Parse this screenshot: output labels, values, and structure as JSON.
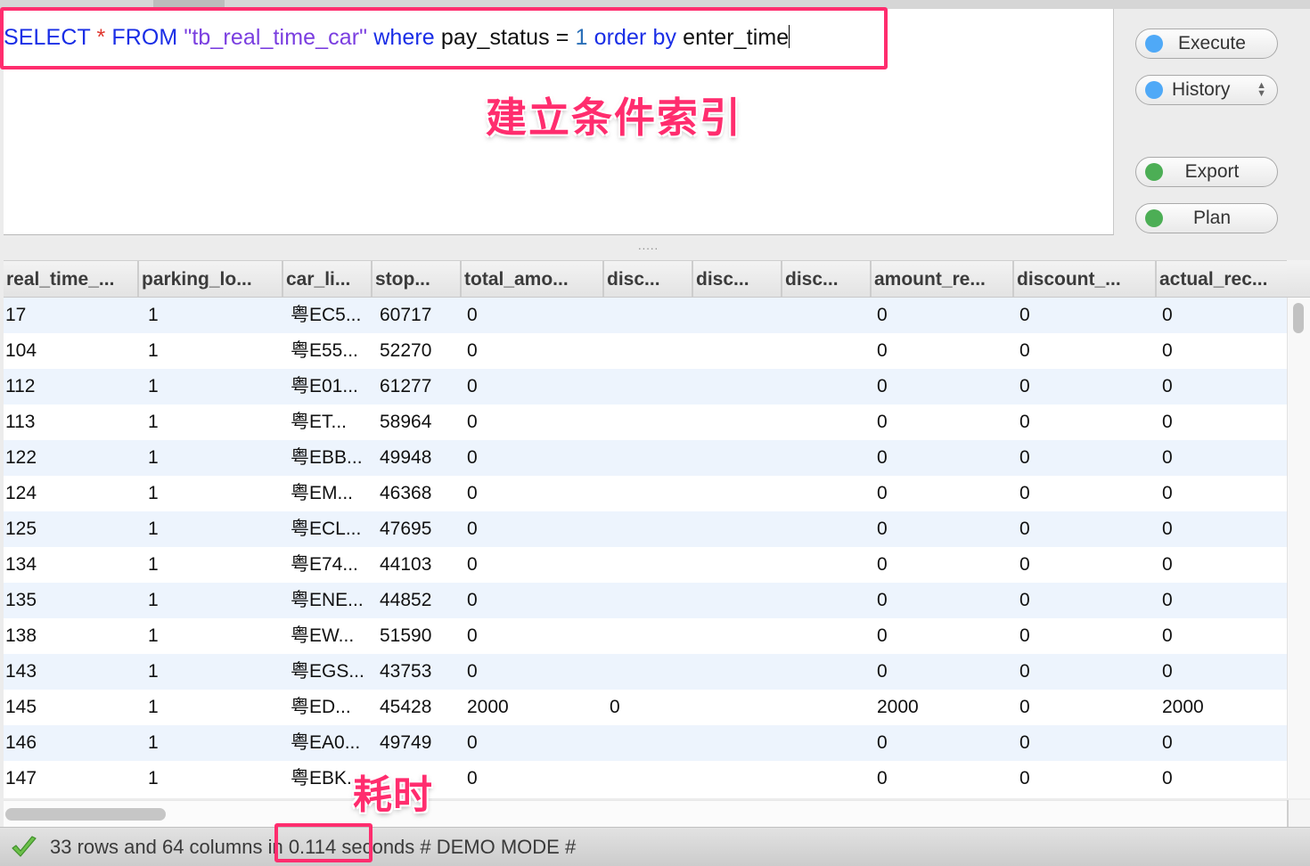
{
  "editor": {
    "sql_tokens": [
      {
        "t": "SELECT",
        "c": "kw"
      },
      {
        "t": " ",
        "c": "plain"
      },
      {
        "t": "*",
        "c": "star"
      },
      {
        "t": " ",
        "c": "plain"
      },
      {
        "t": "FROM",
        "c": "kw"
      },
      {
        "t": " ",
        "c": "plain"
      },
      {
        "t": "\"tb_real_time_car\"",
        "c": "str"
      },
      {
        "t": " ",
        "c": "plain"
      },
      {
        "t": "where",
        "c": "kw"
      },
      {
        "t": " pay_status = ",
        "c": "plain"
      },
      {
        "t": "1",
        "c": "num"
      },
      {
        "t": " ",
        "c": "plain"
      },
      {
        "t": "order by",
        "c": "kw"
      },
      {
        "t": " enter_time",
        "c": "plain"
      }
    ]
  },
  "annotations": {
    "index_note": "建立条件索引",
    "time_note": "耗时"
  },
  "buttons": {
    "execute": "Execute",
    "history": "History",
    "export": "Export",
    "plan": "Plan"
  },
  "splitter": ".....",
  "grid": {
    "columns": [
      "real_time_...",
      "parking_lo...",
      "car_li...",
      "stop...",
      "total_amo...",
      "disc...",
      "disc...",
      "disc...",
      "amount_re...",
      "discount_...",
      "actual_rec..."
    ],
    "rows": [
      [
        "17",
        "1",
        "粤EC5...",
        "60717",
        "0",
        "",
        "",
        "",
        "0",
        "0",
        "0"
      ],
      [
        "104",
        "1",
        "粤E55...",
        "52270",
        "0",
        "",
        "",
        "",
        "0",
        "0",
        "0"
      ],
      [
        "112",
        "1",
        "粤E01...",
        "61277",
        "0",
        "",
        "",
        "",
        "0",
        "0",
        "0"
      ],
      [
        "113",
        "1",
        "粤ET...",
        "58964",
        "0",
        "",
        "",
        "",
        "0",
        "0",
        "0"
      ],
      [
        "122",
        "1",
        "粤EBB...",
        "49948",
        "0",
        "",
        "",
        "",
        "0",
        "0",
        "0"
      ],
      [
        "124",
        "1",
        "粤EM...",
        "46368",
        "0",
        "",
        "",
        "",
        "0",
        "0",
        "0"
      ],
      [
        "125",
        "1",
        "粤ECL...",
        "47695",
        "0",
        "",
        "",
        "",
        "0",
        "0",
        "0"
      ],
      [
        "134",
        "1",
        "粤E74...",
        "44103",
        "0",
        "",
        "",
        "",
        "0",
        "0",
        "0"
      ],
      [
        "135",
        "1",
        "粤ENE...",
        "44852",
        "0",
        "",
        "",
        "",
        "0",
        "0",
        "0"
      ],
      [
        "138",
        "1",
        "粤EW...",
        "51590",
        "0",
        "",
        "",
        "",
        "0",
        "0",
        "0"
      ],
      [
        "143",
        "1",
        "粤EGS...",
        "43753",
        "0",
        "",
        "",
        "",
        "0",
        "0",
        "0"
      ],
      [
        "145",
        "1",
        "粤ED...",
        "45428",
        "2000",
        "0",
        "",
        "",
        "2000",
        "0",
        "2000"
      ],
      [
        "146",
        "1",
        "粤EA0...",
        "49749",
        "0",
        "",
        "",
        "",
        "0",
        "0",
        "0"
      ],
      [
        "147",
        "1",
        "粤EBK...",
        "",
        "0",
        "",
        "",
        "",
        "0",
        "0",
        "0"
      ]
    ]
  },
  "status": {
    "text": "33 rows and 64 columns in 0.114 seconds # DEMO MODE #",
    "elapsed": "0.114",
    "row_count": 33,
    "column_count": 64
  },
  "colors": {
    "annotation": "#ff2d6e",
    "keyword": "#1a2ee6",
    "string": "#7a3ee0",
    "row_alt": "#edf4fd",
    "dot_blue": "#4fa9f7",
    "dot_green": "#4cae55"
  }
}
